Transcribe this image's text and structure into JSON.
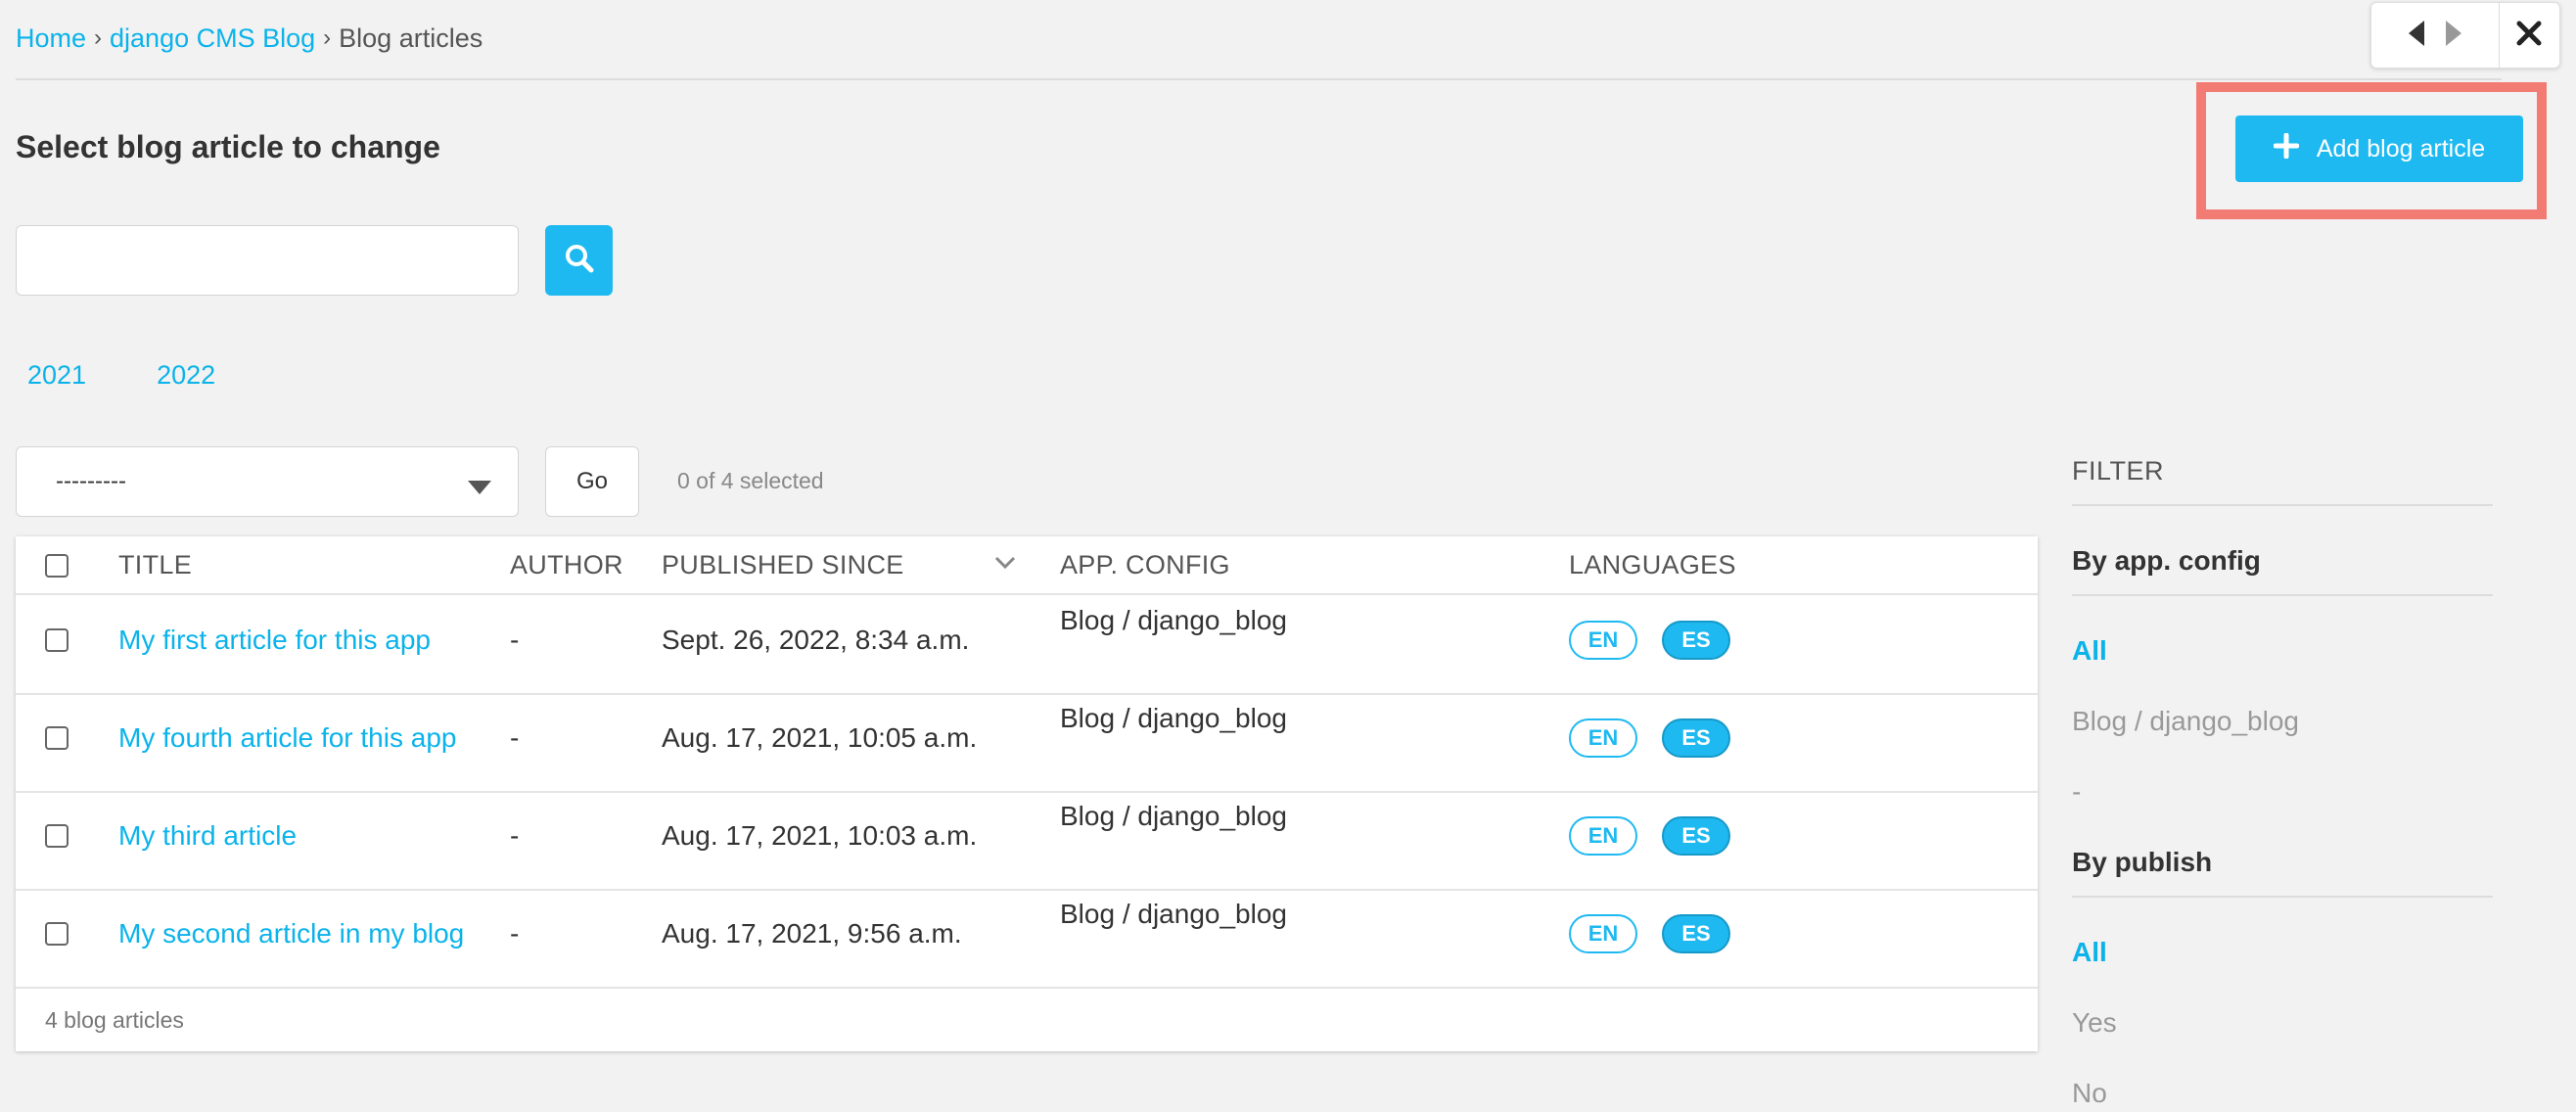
{
  "breadcrumb": {
    "home": "Home",
    "app": "django CMS Blog",
    "current": "Blog articles",
    "separator": "›"
  },
  "nav": {
    "prev_icon": "triangle-left-icon",
    "next_icon": "triangle-right-icon",
    "close_icon": "close-x-icon"
  },
  "page_title": "Select blog article to change",
  "add_button": {
    "label": "Add blog article",
    "icon": "plus-icon"
  },
  "search": {
    "value": "",
    "placeholder": "",
    "icon": "search-icon"
  },
  "date_hierarchy": [
    "2021",
    "2022"
  ],
  "actions": {
    "selected_option": "---------",
    "go_label": "Go",
    "selection_count": "0 of 4 selected"
  },
  "table": {
    "columns": {
      "title": "TITLE",
      "author": "AUTHOR",
      "published": "PUBLISHED SINCE",
      "app_config": "APP. CONFIG",
      "languages": "LANGUAGES"
    },
    "rows": [
      {
        "title": "My first article for this app",
        "author": "-",
        "published": "Sept. 26, 2022, 8:34 a.m.",
        "app_config": "Blog / django_blog",
        "lang_en": "EN",
        "lang_es": "ES"
      },
      {
        "title": "My fourth article for this app",
        "author": "-",
        "published": "Aug. 17, 2021, 10:05 a.m.",
        "app_config": "Blog / django_blog",
        "lang_en": "EN",
        "lang_es": "ES"
      },
      {
        "title": "My third article",
        "author": "-",
        "published": "Aug. 17, 2021, 10:03 a.m.",
        "app_config": "Blog / django_blog",
        "lang_en": "EN",
        "lang_es": "ES"
      },
      {
        "title": "My second article in my blog",
        "author": "-",
        "published": "Aug. 17, 2021, 9:56 a.m.",
        "app_config": "Blog / django_blog",
        "lang_en": "EN",
        "lang_es": "ES"
      }
    ],
    "paginator": "4 blog articles"
  },
  "filter": {
    "title": "FILTER",
    "groups": [
      {
        "title": "By app. config",
        "items": [
          "All",
          "Blog / django_blog",
          "-"
        ]
      },
      {
        "title": "By publish",
        "items": [
          "All",
          "Yes",
          "No"
        ]
      }
    ]
  },
  "colors": {
    "accent": "#1fb9f1",
    "link": "#0bb3ea",
    "highlight": "#f27b74",
    "background": "#f2f2f2"
  }
}
